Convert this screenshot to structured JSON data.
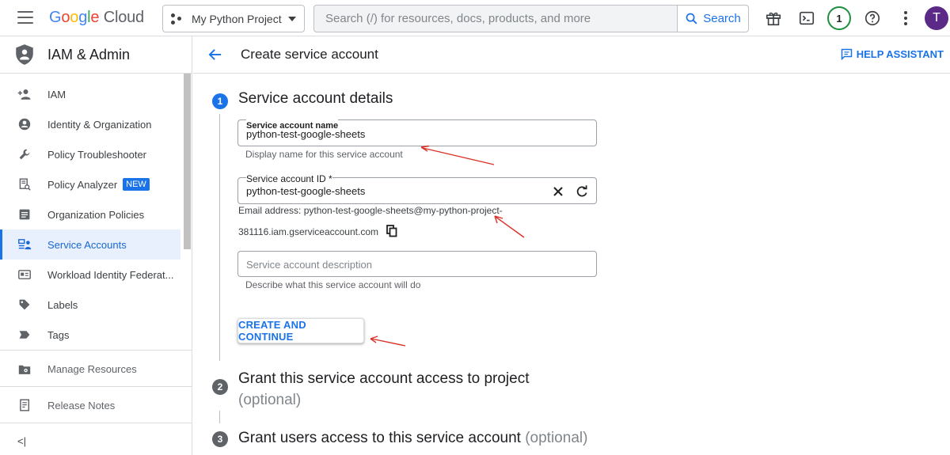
{
  "topbar": {
    "logo_letters": [
      "G",
      "o",
      "o",
      "g",
      "l",
      "e"
    ],
    "logo_suffix": "Cloud",
    "project_name": "My Python Project",
    "search_placeholder": "Search (/) for resources, docs, products, and more",
    "search_button": "Search",
    "notification_count": "1",
    "avatar_initial": "T"
  },
  "sidebar": {
    "title": "IAM & Admin",
    "items": [
      {
        "label": "IAM",
        "icon": "person-add-icon"
      },
      {
        "label": "Identity & Organization",
        "icon": "account-circle-icon"
      },
      {
        "label": "Policy Troubleshooter",
        "icon": "wrench-icon"
      },
      {
        "label": "Policy Analyzer",
        "icon": "document-search-icon",
        "badge": "NEW"
      },
      {
        "label": "Organization Policies",
        "icon": "policy-list-icon"
      },
      {
        "label": "Service Accounts",
        "icon": "service-account-icon",
        "active": true
      },
      {
        "label": "Workload Identity Federat...",
        "icon": "id-card-icon"
      },
      {
        "label": "Labels",
        "icon": "label-icon"
      },
      {
        "label": "Tags",
        "icon": "tag-icon"
      }
    ],
    "manage_resources": "Manage Resources",
    "release_notes": "Release Notes",
    "collapse": "<|"
  },
  "header": {
    "title": "Create service account",
    "help": "HELP ASSISTANT"
  },
  "steps": [
    {
      "number": "1",
      "title": "Service account details",
      "optional": ""
    },
    {
      "number": "2",
      "title": "Grant this service account access to project",
      "optional": "(optional)"
    },
    {
      "number": "3",
      "title": "Grant users access to this service account",
      "optional": "(optional)"
    }
  ],
  "form": {
    "name_label": "Service account name",
    "name_value": "python-test-google-sheets",
    "name_helper": "Display name for this service account",
    "id_label": "Service account ID *",
    "id_value": "python-test-google-sheets",
    "email_line1": "Email address: python-test-google-sheets@my-python-project-",
    "email_line2": "381116.iam.gserviceaccount.com",
    "description_placeholder": "Service account description",
    "description_helper": "Describe what this service account will do",
    "submit": "CREATE AND CONTINUE"
  },
  "colors": {
    "accent": "#1a73e8",
    "annotation": "#d93025"
  }
}
